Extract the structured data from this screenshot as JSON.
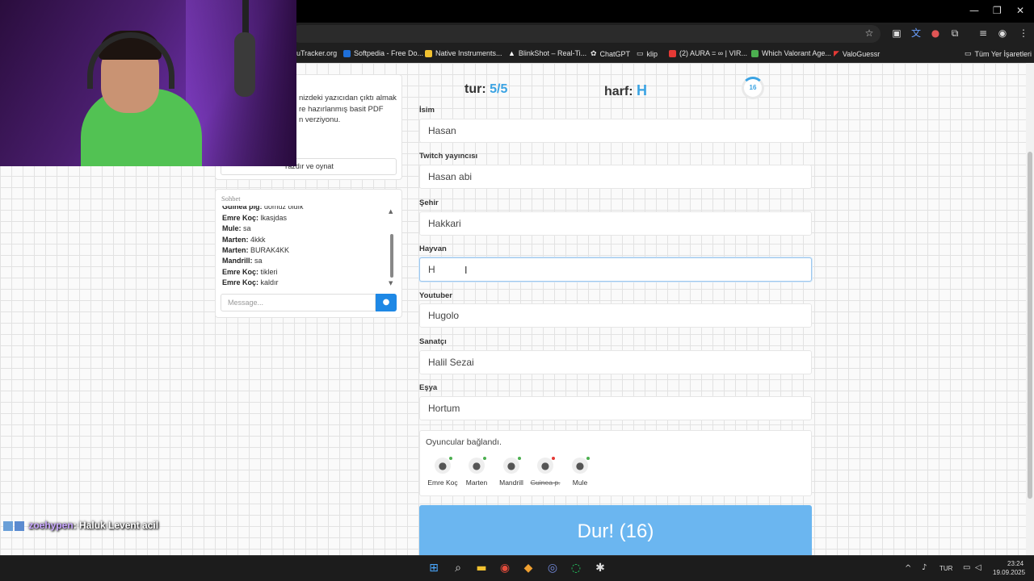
{
  "browser": {
    "bookmarks": [
      {
        "label": "uTracker.org",
        "color": "#1f1f1f"
      },
      {
        "label": "Softpedia - Free Do...",
        "color": "#1e6fd9"
      },
      {
        "label": "Native Instruments...",
        "color": "#f2c230"
      },
      {
        "label": "BlinkShot – Real-Ti...",
        "color": "#ffffff"
      },
      {
        "label": "ChatGPT",
        "color": "#cccccc"
      },
      {
        "label": "klip",
        "color": "#cccccc"
      },
      {
        "label": "(2) AURA = ∞ | VIR...",
        "color": "#e53935"
      },
      {
        "label": "Which Valorant Age...",
        "color": "#4caf50"
      },
      {
        "label": "ValoGuessr",
        "color": "#e53935"
      }
    ],
    "all_bookmarks": "Tüm Yer İşaretleri"
  },
  "left_panel": {
    "info_lines": [
      "nizdeki yazıcıdan çıktı almak",
      "re hazırlanmış basit PDF",
      "n verziyonu."
    ],
    "print_button": "Yazdır ve oynat"
  },
  "chat": {
    "title": "Sohbet",
    "messages": [
      {
        "user": "Guinea pig:",
        "text": "domuz oldık"
      },
      {
        "user": "Emre Koç:",
        "text": "lkasjdas"
      },
      {
        "user": "Mule:",
        "text": "sa"
      },
      {
        "user": "Marten:",
        "text": "4kkk"
      },
      {
        "user": "Marten:",
        "text": "BURAK4KK"
      },
      {
        "user": "Mandrill:",
        "text": "sa"
      },
      {
        "user": "Emre Koç:",
        "text": "tikleri"
      },
      {
        "user": "Emre Koç:",
        "text": "kaldır"
      }
    ],
    "message_placeholder": "Message..."
  },
  "game": {
    "tur_label": "tur:",
    "tur_value": "5/5",
    "harf_label": "harf:",
    "harf_value": "H",
    "timer": "16",
    "fields": [
      {
        "label": "İsim",
        "value": "Hasan"
      },
      {
        "label": "Twitch yayıncısı",
        "value": "Hasan abi"
      },
      {
        "label": "Şehir",
        "value": "Hakkari"
      },
      {
        "label": "Hayvan",
        "value": "H"
      },
      {
        "label": "Youtuber",
        "value": "Hugolo"
      },
      {
        "label": "Sanatçı",
        "value": "Halil Sezai"
      },
      {
        "label": "Eşya",
        "value": "Hortum"
      }
    ],
    "players_title": "Oyuncular bağlandı.",
    "players": [
      {
        "name": "Emre Koç",
        "status_color": "#4caf50",
        "struck": false,
        "icon": "user-star-icon"
      },
      {
        "name": "Marten",
        "status_color": "#4caf50",
        "struck": false,
        "icon": "user-icon"
      },
      {
        "name": "Mandrill",
        "status_color": "#4caf50",
        "struck": false,
        "icon": "user-icon"
      },
      {
        "name": "Guinea p.",
        "status_color": "#e53935",
        "struck": true,
        "icon": "user-icon"
      },
      {
        "name": "Mule",
        "status_color": "#4caf50",
        "struck": false,
        "icon": "user-icon"
      }
    ],
    "stop_button": "Dur! (16)"
  },
  "stream_overlay": {
    "chat_user": "zoehypen",
    "chat_text": ": Haluk Levent acil"
  },
  "taskbar": {
    "language": "TUR",
    "time": "23:24",
    "date": "19.09.2025"
  }
}
